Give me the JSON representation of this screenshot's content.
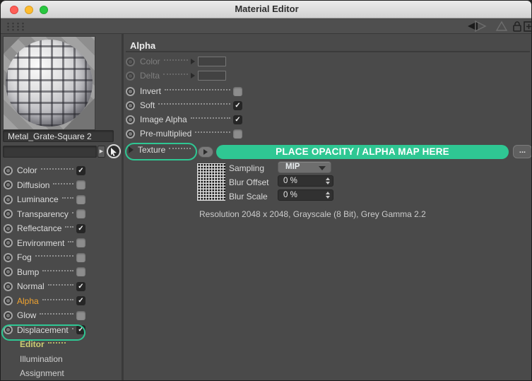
{
  "window": {
    "title": "Material Editor"
  },
  "left": {
    "material_name": "Metal_Grate-Square 2",
    "channels": [
      {
        "label": "Color",
        "check": "✓"
      },
      {
        "label": "Diffusion",
        "check": ""
      },
      {
        "label": "Luminance",
        "check": ""
      },
      {
        "label": "Transparency",
        "check": ""
      },
      {
        "label": "Reflectance",
        "check": "✓"
      },
      {
        "label": "Environment",
        "check": ""
      },
      {
        "label": "Fog",
        "check": ""
      },
      {
        "label": "Bump",
        "check": ""
      },
      {
        "label": "Normal",
        "check": "✓"
      },
      {
        "label": "Alpha",
        "check": "✓"
      },
      {
        "label": "Glow",
        "check": ""
      },
      {
        "label": "Displacement",
        "check": "✓"
      }
    ],
    "modes": [
      {
        "label": "Editor"
      },
      {
        "label": "Illumination"
      },
      {
        "label": "Assignment"
      }
    ]
  },
  "right": {
    "header": "Alpha",
    "color_row": {
      "label": "Color"
    },
    "delta_row": {
      "label": "Delta"
    },
    "toggles": [
      {
        "label": "Invert",
        "check": ""
      },
      {
        "label": "Soft",
        "check": "✓"
      },
      {
        "label": "Image Alpha",
        "check": "✓"
      },
      {
        "label": "Pre-multiplied",
        "check": ""
      }
    ],
    "texture": {
      "label": "Texture",
      "annotation": "PLACE OPACITY / ALPHA MAP HERE",
      "more_label": "..."
    },
    "sampling": {
      "label": "Sampling",
      "value": "MIP"
    },
    "blur_offset": {
      "label": "Blur Offset",
      "value": "0 %"
    },
    "blur_scale": {
      "label": "Blur Scale",
      "value": "0 %"
    },
    "resolution": "Resolution 2048 x 2048, Grayscale (8 Bit), Grey Gamma 2.2"
  },
  "colors": {
    "annotation_green": "#2fc793",
    "alpha_label_orange": "#f0a330",
    "editor_yellow": "#cdcd73"
  }
}
